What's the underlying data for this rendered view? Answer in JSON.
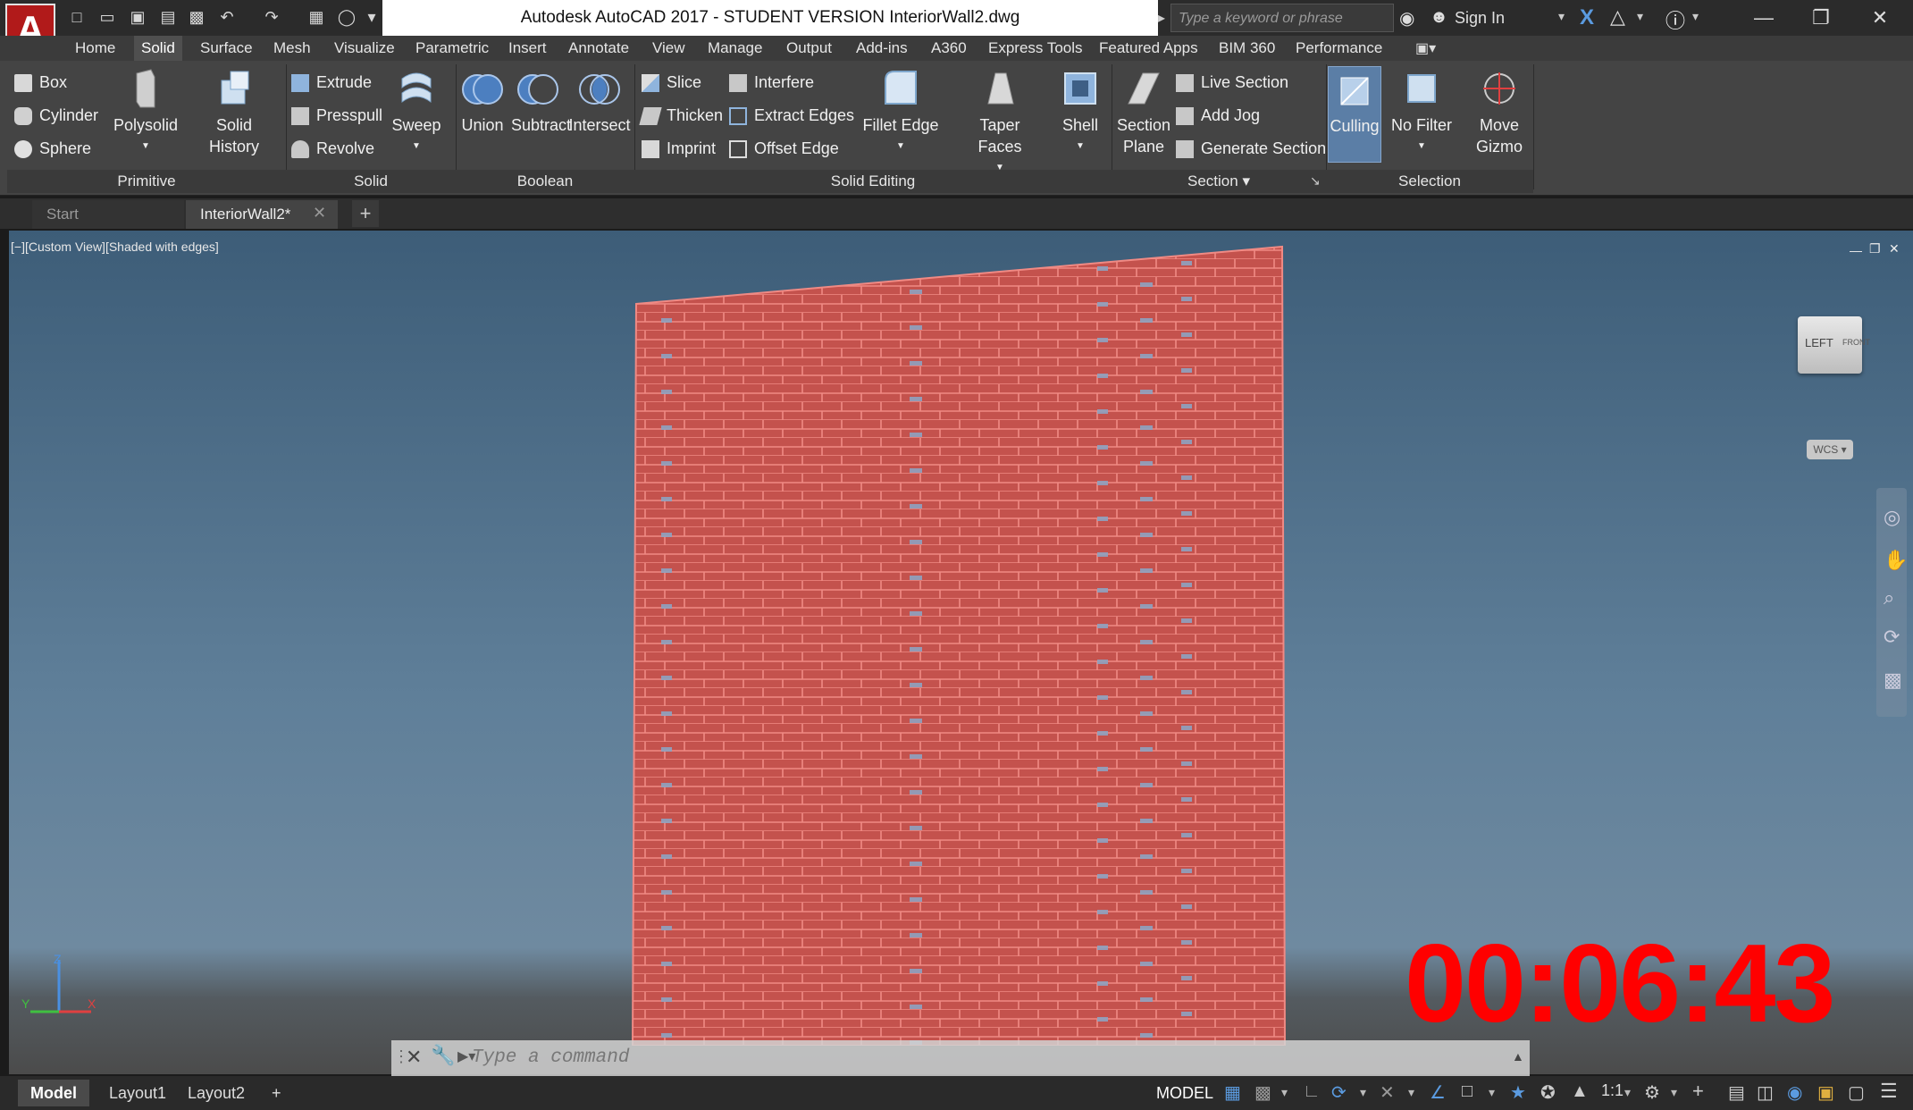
{
  "titlebar": {
    "title": "Autodesk AutoCAD 2017 - STUDENT VERSION    InteriorWall2.dwg",
    "search_placeholder": "Type a keyword or phrase",
    "sign_in": "Sign In"
  },
  "ribbon_tabs": [
    "Home",
    "Solid",
    "Surface",
    "Mesh",
    "Visualize",
    "Parametric",
    "Insert",
    "Annotate",
    "View",
    "Manage",
    "Output",
    "Add-ins",
    "A360",
    "Express Tools",
    "Featured Apps",
    "BIM 360",
    "Performance"
  ],
  "active_tab": "Solid",
  "primitive": {
    "box": "Box",
    "cylinder": "Cylinder",
    "sphere": "Sphere",
    "polysolid": "Polysolid",
    "solid_history": "Solid History",
    "label": "Primitive"
  },
  "solid": {
    "extrude": "Extrude",
    "presspull": "Presspull",
    "revolve": "Revolve",
    "sweep": "Sweep",
    "label": "Solid"
  },
  "boolean": {
    "union": "Union",
    "subtract": "Subtract",
    "intersect": "Intersect",
    "label": "Boolean"
  },
  "solid_editing": {
    "slice": "Slice",
    "thicken": "Thicken",
    "imprint": "Imprint",
    "interfere": "Interfere",
    "extract_edges": "Extract Edges",
    "offset_edge": "Offset Edge",
    "fillet_edge": "Fillet Edge",
    "taper_faces": "Taper Faces",
    "shell": "Shell",
    "label": "Solid Editing"
  },
  "section": {
    "plane_line1": "Section",
    "plane_line2": "Plane",
    "live_section": "Live Section",
    "add_jog": "Add Jog",
    "generate_section": "Generate Section",
    "label": "Section"
  },
  "selection": {
    "culling": "Culling",
    "no_filter": "No Filter",
    "gizmo_line1": "Move",
    "gizmo_line2": "Gizmo",
    "label": "Selection"
  },
  "doc_tabs": {
    "start": "Start",
    "drawing": "InteriorWall2*"
  },
  "viewport": {
    "label": "[−][Custom View][Shaded with edges]",
    "viewcube_left": "LEFT",
    "viewcube_front": "FRONT",
    "wcs": "WCS",
    "timer": "00:06:43",
    "command_placeholder": "Type a command"
  },
  "layout_tabs": [
    "Model",
    "Layout1",
    "Layout2"
  ],
  "status": {
    "model": "MODEL",
    "scale": "1:1"
  },
  "colors": {
    "wall_fill": "#c4524d",
    "wall_edge": "#f08a84",
    "timer": "#ff0000",
    "accent": "#5b7ea6"
  }
}
